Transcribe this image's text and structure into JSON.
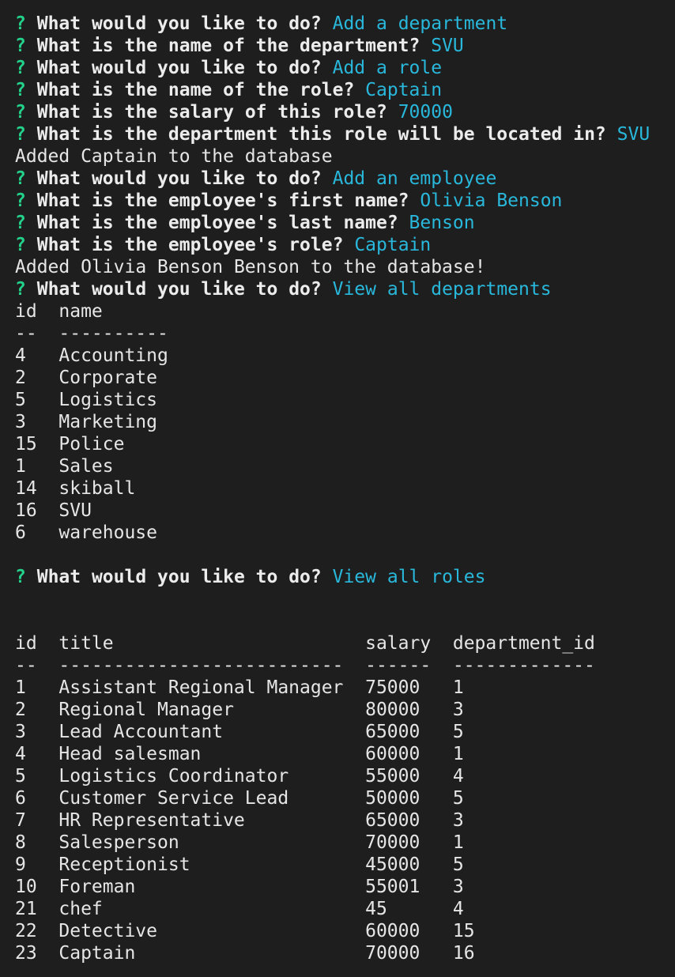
{
  "prompt_marker": "?",
  "qa": [
    {
      "q": "What would you like to do?",
      "a": "Add a department"
    },
    {
      "q": "What is the name of the department?",
      "a": "SVU"
    },
    {
      "q": "What would you like to do?",
      "a": "Add a role"
    },
    {
      "q": "What is the name of the role?",
      "a": "Captain"
    },
    {
      "q": "What is the salary of this role?",
      "a": "70000"
    },
    {
      "q": "What is the department this role will be located in?",
      "a": "SVU"
    },
    {
      "q": "What would you like to do?",
      "a": "Add an employee"
    },
    {
      "q": "What is the employee's first name?",
      "a": "Olivia Benson"
    },
    {
      "q": "What is the employee's last name?",
      "a": "Benson"
    },
    {
      "q": "What is the employee's role?",
      "a": "Captain"
    },
    {
      "q": "What would you like to do?",
      "a": "View all departments"
    },
    {
      "q": "What would you like to do?",
      "a": "View all roles"
    }
  ],
  "messages": {
    "added_role": "Added Captain to the database",
    "added_employee": "Added Olivia Benson Benson to the database!"
  },
  "departments_table": {
    "headers": [
      "id",
      "name"
    ],
    "separators": [
      "--",
      "----------"
    ],
    "rows": [
      [
        "4",
        "Accounting"
      ],
      [
        "2",
        "Corporate"
      ],
      [
        "5",
        "Logistics"
      ],
      [
        "3",
        "Marketing"
      ],
      [
        "15",
        "Police"
      ],
      [
        "1",
        "Sales"
      ],
      [
        "14",
        "skiball"
      ],
      [
        "16",
        "SVU"
      ],
      [
        "6",
        "warehouse"
      ]
    ]
  },
  "roles_table": {
    "headers": [
      "id",
      "title",
      "salary",
      "department_id"
    ],
    "separators": [
      "--",
      "--------------------------",
      "------",
      "-------------"
    ],
    "rows": [
      [
        "1",
        "Assistant Regional Manager",
        "75000",
        "1"
      ],
      [
        "2",
        "Regional Manager",
        "80000",
        "3"
      ],
      [
        "3",
        "Lead Accountant",
        "65000",
        "5"
      ],
      [
        "4",
        "Head salesman",
        "60000",
        "1"
      ],
      [
        "5",
        "Logistics Coordinator",
        "55000",
        "4"
      ],
      [
        "6",
        "Customer Service Lead",
        "50000",
        "5"
      ],
      [
        "7",
        "HR Representative",
        "65000",
        "3"
      ],
      [
        "8",
        "Salesperson",
        "70000",
        "1"
      ],
      [
        "9",
        "Receptionist",
        "45000",
        "5"
      ],
      [
        "10",
        "Foreman",
        "55001",
        "3"
      ],
      [
        "21",
        "chef",
        "45",
        "4"
      ],
      [
        "22",
        "Detective",
        "60000",
        "15"
      ],
      [
        "23",
        "Captain",
        "70000",
        "16"
      ]
    ]
  },
  "colors": {
    "background": "#1e1e1e",
    "marker": "#23d18b",
    "answer": "#29b8db",
    "text": "#e6e6e6"
  }
}
